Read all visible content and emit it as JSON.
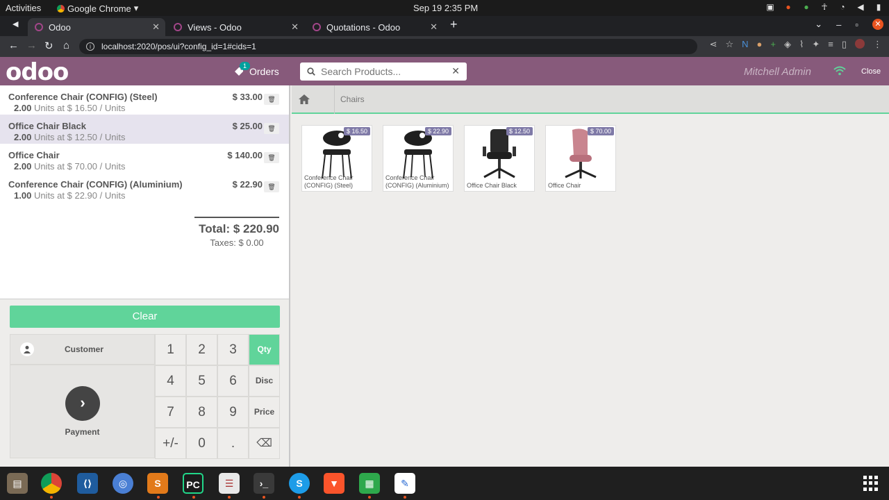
{
  "system_bar": {
    "activities": "Activities",
    "app_name": "Google Chrome",
    "clock": "Sep 19  2:35 PM"
  },
  "browser": {
    "tabs": [
      {
        "title": "Odoo"
      },
      {
        "title": "Views - Odoo"
      },
      {
        "title": "Quotations - Odoo"
      }
    ],
    "url": "localhost:2020/pos/ui?config_id=1#cids=1"
  },
  "pos_header": {
    "logo": "odoo",
    "orders_label": "Orders",
    "orders_badge": "1",
    "search_placeholder": "Search Products...",
    "user_name": "Mitchell Admin",
    "close_label": "Close"
  },
  "order": {
    "lines": [
      {
        "name": "Conference Chair (CONFIG) (Steel)",
        "qty": "2.00",
        "unit_text": "Units at $ 16.50 / Units",
        "price": "$ 33.00"
      },
      {
        "name": "Office Chair Black",
        "qty": "2.00",
        "unit_text": "Units at $ 12.50 / Units",
        "price": "$ 25.00"
      },
      {
        "name": "Office Chair",
        "qty": "2.00",
        "unit_text": "Units at $ 70.00 / Units",
        "price": "$ 140.00"
      },
      {
        "name": "Conference Chair (CONFIG) (Aluminium)",
        "qty": "1.00",
        "unit_text": "Units at $ 22.90 / Units",
        "price": "$ 22.90"
      }
    ],
    "total": "Total: $ 220.90",
    "taxes": "Taxes: $ 0.00"
  },
  "controls": {
    "clear": "Clear",
    "customer": "Customer",
    "payment": "Payment",
    "numpad": {
      "k1": "1",
      "k2": "2",
      "k3": "3",
      "qty": "Qty",
      "k4": "4",
      "k5": "5",
      "k6": "6",
      "disc": "Disc",
      "k7": "7",
      "k8": "8",
      "k9": "9",
      "price": "Price",
      "plusminus": "+/-",
      "k0": "0",
      "dot": ".",
      "backspace": "⌫"
    },
    "active_mode": "Qty"
  },
  "catalog": {
    "breadcrumb": "Chairs",
    "products": [
      {
        "price": "$ 16.50",
        "name": "Conference Chair (CONFIG) (Steel)"
      },
      {
        "price": "$ 22.90",
        "name": "Conference Chair (CONFIG) (Aluminium)"
      },
      {
        "price": "$ 12.50",
        "name": "Office Chair Black"
      },
      {
        "price": "$ 70.00",
        "name": "Office Chair"
      }
    ]
  },
  "colors": {
    "odoo_purple": "#875a7b",
    "pos_green": "#60d49a",
    "price_tag": "#7f7aa7"
  }
}
